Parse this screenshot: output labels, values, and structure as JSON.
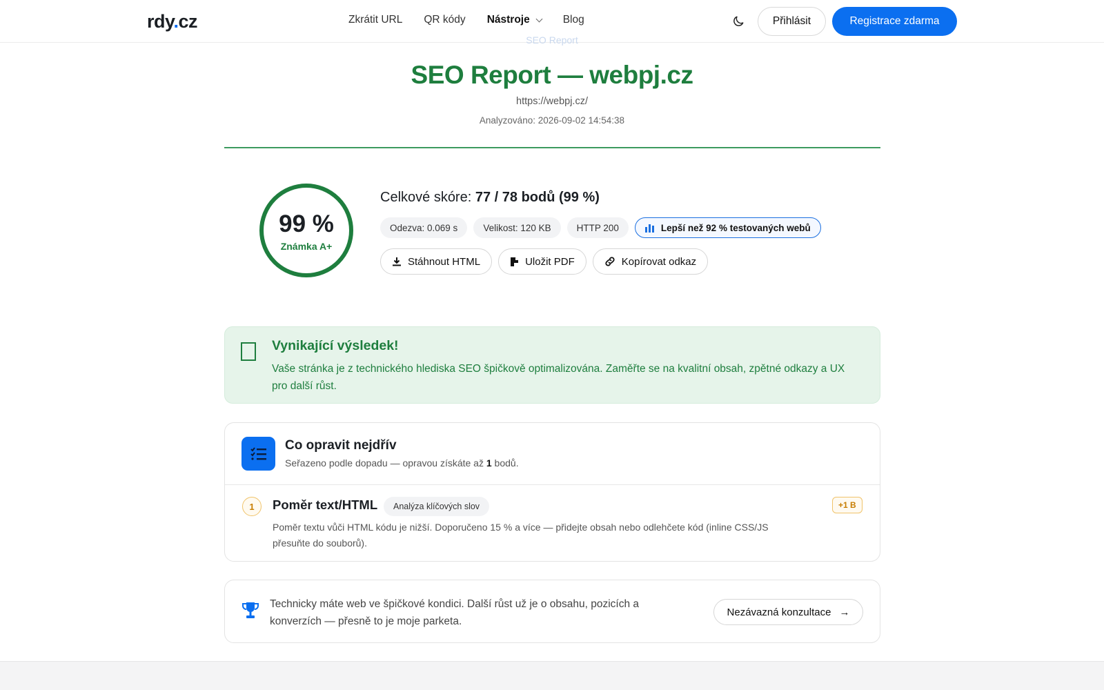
{
  "header": {
    "logo_main": "rdy",
    "logo_dot": ".",
    "logo_tld": "cz",
    "nav": [
      {
        "label": "Zkrátit URL"
      },
      {
        "label": "QR kódy"
      },
      {
        "label": "Nástroje"
      },
      {
        "label": "Blog"
      }
    ],
    "theme_icon": "moon-icon",
    "login_label": "Přihlásit",
    "register_label": "Registrace zdarma"
  },
  "ghost_label": "SEO Report",
  "report": {
    "title": "SEO Report — webpj.cz",
    "url": "https://webpj.cz/",
    "analyzed": "Analyzováno: 2026-09-02 14:54:38"
  },
  "score": {
    "percent_text": "99 %",
    "percent_value": 99,
    "grade": "Známka A+",
    "line_prefix": "Celkové skóre: ",
    "points": "77 / 78",
    "line_suffix": " bodů (99 %)",
    "chips": [
      {
        "label": "Odezva: 0.069 s"
      },
      {
        "label": "Velikost: 120 KB"
      },
      {
        "label": "HTTP 200"
      }
    ],
    "better_label": "Lepší než 92 % testovaných webů",
    "actions": [
      {
        "label": "Stáhnout HTML",
        "icon": "download-icon"
      },
      {
        "label": "Uložit PDF",
        "icon": "pdf-icon"
      },
      {
        "label": "Kopírovat odkaz",
        "icon": "link-icon"
      }
    ]
  },
  "success": {
    "title": "Vynikající výsledek!",
    "text": "Vaše stránka je z technického hlediska SEO špičkově optimalizována. Zaměřte se na kvalitní obsah, zpětné odkazy a UX pro další růst."
  },
  "fixes": {
    "title": "Co opravit nejdřív",
    "sub_prefix": "Seřazeno podle dopadu — opravou získáte až ",
    "sub_points": "1",
    "sub_suffix": " bodů.",
    "items": [
      {
        "num": "1",
        "title": "Poměr text/HTML",
        "tag": "Analýza klíčových slov",
        "points": "+1 B",
        "desc": "Poměr textu vůči HTML kódu je nižší. Doporučeno 15 % a více — přidejte obsah nebo odlehčete kód (inline CSS/JS přesuňte do souborů)."
      }
    ]
  },
  "cta": {
    "text": "Technicky máte web ve špičkové kondici. Další růst už je o obsahu, pozicích a konverzích — přesně to je moje parketa.",
    "button_label": "Nezávazná konzultace",
    "button_arrow": "→"
  },
  "colors": {
    "accent": "#0b6ff0",
    "success": "#1e7e3e",
    "success_bg": "#e6f4ea",
    "warning": "#c77d00"
  }
}
